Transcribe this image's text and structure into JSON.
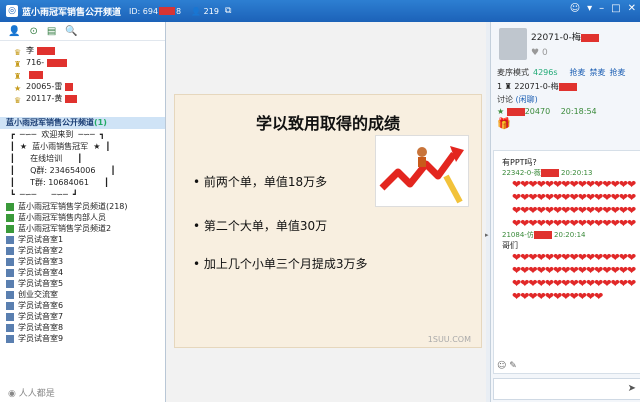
{
  "window": {
    "title": "蓝小雨冠军销售公开频道",
    "room_id": "ID: 694",
    "room_id_tail": "8",
    "online_count": "219"
  },
  "left": {
    "users": [
      {
        "name": "李"
      },
      {
        "name": "716-"
      },
      {
        "name": ""
      },
      {
        "name": "20065-雷"
      },
      {
        "name": "20117-黄"
      }
    ],
    "channel_header": "蓝小雨冠军销售公开频道",
    "channel_count": "(1)",
    "deco_rows": [
      "┏  ─∽─  欢迎来到  ─∽─  ┓",
      "┃  ★  蓝小雨销售冠军  ★  ┃",
      "┃      在线培训      ┃",
      "┃      Q群: 234654006      ┃",
      "┃      T群: 10684061      ┃",
      "┗  ─∽─      ─∽─  ┛"
    ],
    "rooms": [
      "蓝小雨冠军销售学员频道(218)",
      "蓝小雨冠军销售内部人员",
      "蓝小雨冠军销售学员频道2",
      "学员试音室1",
      "学员试音室2",
      "学员试音室3",
      "学员试音室4",
      "学员试音室5",
      "创业交流室",
      "学员试音室6",
      "学员试音室7",
      "学员试音室8",
      "学员试音室9"
    ],
    "watermark": "人人都是"
  },
  "slide": {
    "title": "学以致用取得的成绩",
    "bullets": [
      "前两个单，单值18万多",
      "第二个大单，单值30万",
      "加上几个小单三个月提成3万多"
    ],
    "watermark": "1SUU.COM"
  },
  "right": {
    "profile_name": "22071-0-梅",
    "likes": "0",
    "mode_label": "麦序模式",
    "mode_value": "4296s",
    "links": [
      "抢麦",
      "禁麦",
      "抢麦"
    ],
    "mic_entry": "22071-0-梅",
    "mic_index": "1",
    "discussion_label": "讨论",
    "discussion_status": "(闲聊)",
    "msg1_meta": "20470",
    "msg1_time": "20:18:54",
    "msg2_text": "有PPT吗?",
    "msg2_meta": "22342-0-薇",
    "msg2_time": "20:20:13",
    "msg3_meta": "21084-仿",
    "msg3_time": "20:20:14",
    "msg3_text": "哥们",
    "hearts_a": "❤❤❤❤❤❤❤❤❤❤❤❤❤❤❤❤❤❤❤❤❤❤❤❤❤❤❤❤❤❤❤❤❤❤❤❤❤❤❤❤❤❤❤❤❤❤❤❤❤❤❤❤❤❤❤❤❤❤❤❤",
    "hearts_b": "❤❤❤❤❤❤❤❤❤❤❤❤❤❤❤❤❤❤❤❤❤❤❤❤❤❤❤❤❤❤❤❤❤❤❤❤❤❤❤❤❤❤❤❤❤❤❤❤❤❤❤❤❤❤❤❤"
  }
}
